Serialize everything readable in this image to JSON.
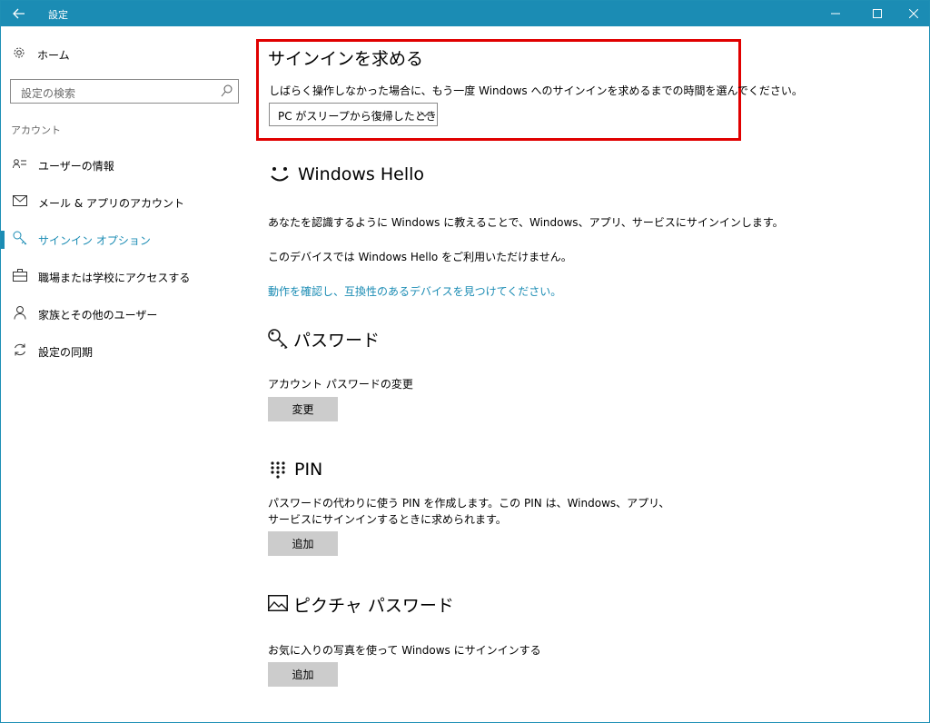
{
  "titlebar": {
    "back_icon": "back-arrow-icon",
    "title": "設定",
    "minimize_icon": "minimize-icon",
    "maximize_icon": "maximize-icon",
    "close_icon": "close-icon"
  },
  "sidebar": {
    "home_label": "ホーム",
    "search_placeholder": "設定の検索",
    "section_label": "アカウント",
    "items": [
      {
        "label": "ユーザーの情報",
        "icon": "user-info-icon",
        "active": false
      },
      {
        "label": "メール & アプリのアカウント",
        "icon": "mail-icon",
        "active": false
      },
      {
        "label": "サインイン オプション",
        "icon": "key-icon",
        "active": true
      },
      {
        "label": "職場または学校にアクセスする",
        "icon": "briefcase-icon",
        "active": false
      },
      {
        "label": "家族とその他のユーザー",
        "icon": "person-icon",
        "active": false
      },
      {
        "label": "設定の同期",
        "icon": "sync-icon",
        "active": false
      }
    ]
  },
  "main": {
    "require_signin": {
      "title": "サインインを求める",
      "description": "しばらく操作しなかった場合に、もう一度 Windows へのサインインを求めるまでの時間を選んでください。",
      "dropdown_value": "PC がスリープから復帰したとき"
    },
    "hello": {
      "title": "Windows Hello",
      "description": "あなたを認識するように Windows に教えることで、Windows、アプリ、サービスにサインインします。",
      "unavailable": "このデバイスでは Windows Hello をご利用いただけません。",
      "link": "動作を確認し、互換性のあるデバイスを見つけてください。"
    },
    "password": {
      "title": "パスワード",
      "subtitle": "アカウント パスワードの変更",
      "button": "変更"
    },
    "pin": {
      "title": "PIN",
      "description_line1": "パスワードの代わりに使う PIN を作成します。この PIN は、Windows、アプリ、",
      "description_line2": "サービスにサインインするときに求められます。",
      "button": "追加"
    },
    "picture": {
      "title": "ピクチャ パスワード",
      "description": "お気に入りの写真を使って Windows にサインインする",
      "button": "追加"
    }
  },
  "colors": {
    "accent": "#1b8cb4",
    "highlight_border": "#e00000",
    "button_bg": "#cccccc"
  }
}
